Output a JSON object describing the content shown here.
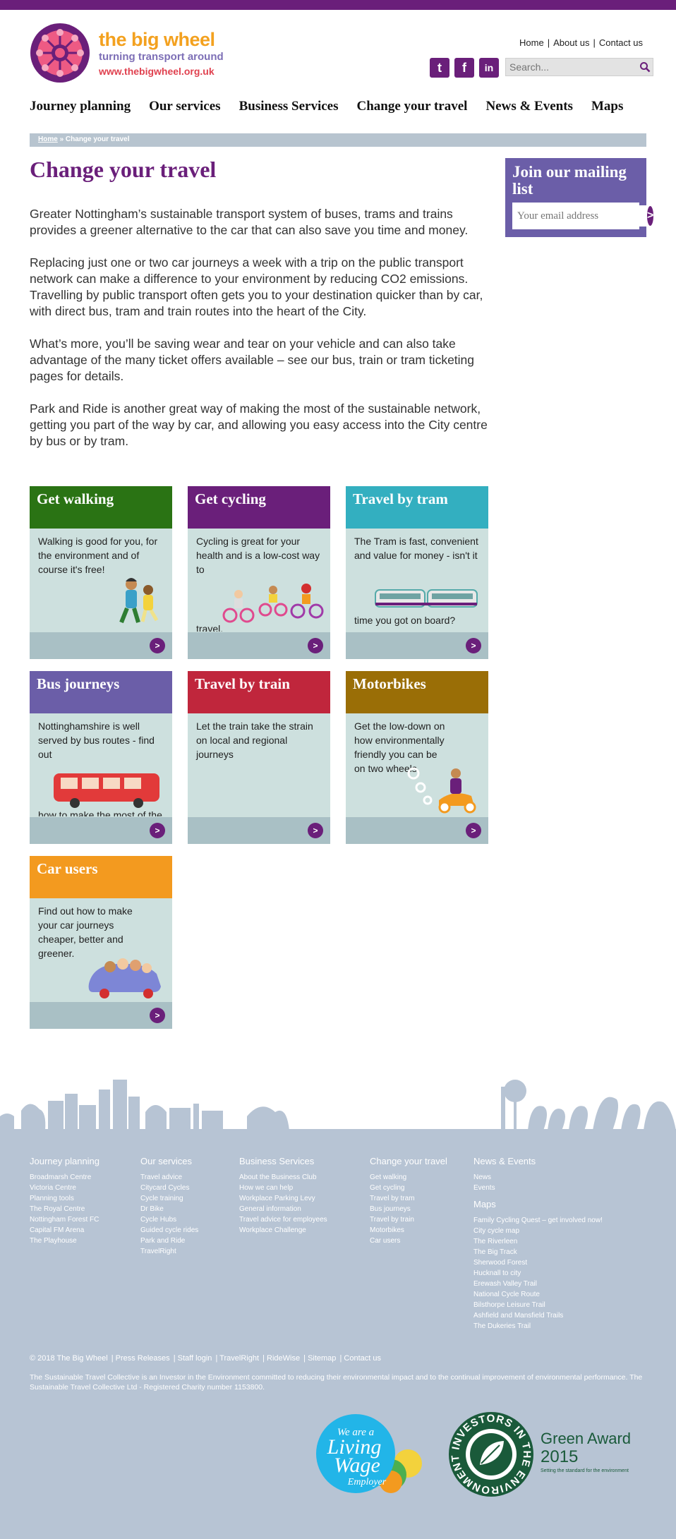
{
  "brand": {
    "name": "the big wheel",
    "tagline": "turning transport around",
    "url": "www.thebigwheel.org.uk"
  },
  "top_links": [
    "Home",
    "About us",
    "Contact us"
  ],
  "social": [
    {
      "icon": "twitter-icon",
      "glyph": "t"
    },
    {
      "icon": "facebook-icon",
      "glyph": "f"
    },
    {
      "icon": "linkedin-icon",
      "glyph": "in"
    }
  ],
  "search": {
    "placeholder": "Search..."
  },
  "nav": [
    "Journey planning",
    "Our services",
    "Business Services",
    "Change your travel",
    "News & Events",
    "Maps"
  ],
  "breadcrumb": {
    "home": "Home",
    "sep": "»",
    "current": "Change your travel"
  },
  "page_title": "Change your travel",
  "paragraphs": [
    "Greater Nottingham’s sustainable transport system of buses, trams and trains provides a greener alternative to the car that can also save you time and money.",
    "Replacing just one or two car journeys a week with a trip on the public transport network can make a difference to your environment by reducing CO2 emissions. Travelling by public transport often gets you to your destination quicker than by car, with direct bus, tram and train routes into the heart of the City.",
    "What’s more, you’ll be saving wear and tear on your vehicle and can also take advantage of the many ticket offers available – see our bus, train or tram ticketing pages for details.",
    "Park and Ride is another great way of making the most of the sustainable network, getting you part of the way by car, and allowing you easy access into the City centre by bus or by tram."
  ],
  "mailing": {
    "title": "Join our mailing list",
    "placeholder": "Your email address",
    "button": ">"
  },
  "cards": [
    {
      "title": "Get walking",
      "text": "Walking is good for you, for the environment and of course it's free!",
      "color": "#2a7314",
      "arrow": ">"
    },
    {
      "title": "Get cycling",
      "text": "Cycling is great for your health and is a low-cost way to",
      "text2": "travel.",
      "color": "#6a1f7a",
      "arrow": ">"
    },
    {
      "title": "Travel by tram",
      "text": "The Tram is fast, convenient and value for money - isn't it",
      "text2": "time you got on board?",
      "color": "#33afc0",
      "arrow": ">"
    },
    {
      "title": "Bus journeys",
      "text": "Nottinghamshire is well served by bus routes - find out",
      "text2": "how to make the most of the",
      "color": "#6b5ea8",
      "arrow": ">"
    },
    {
      "title": "Travel by train",
      "text": "Let the train take the strain on local and regional journeys",
      "color": "#c0263c",
      "arrow": ">"
    },
    {
      "title": "Motorbikes",
      "text": "Get the low-down on how environmentally friendly you can be on two wheels.",
      "color": "#9a6e06",
      "arrow": ">"
    },
    {
      "title": "Car users",
      "text": "Find out how to make your car journeys cheaper, better and greener.",
      "color": "#f39a1f",
      "arrow": ">"
    }
  ],
  "footer": {
    "columns": [
      {
        "title": "Journey planning",
        "links": [
          "Broadmarsh Centre",
          "Victoria Centre",
          "Planning tools",
          "The Royal Centre",
          "Nottingham Forest FC",
          "Capital FM Arena",
          "The Playhouse"
        ]
      },
      {
        "title": "Our services",
        "links": [
          "Travel advice",
          "Citycard Cycles",
          "Cycle training",
          "Dr Bike",
          "Cycle Hubs",
          "Guided cycle rides",
          "Park and Ride",
          "TravelRight"
        ]
      },
      {
        "title": "Business Services",
        "links": [
          "About the Business Club",
          "How we can help",
          "Workplace Parking Levy",
          "General information",
          "Travel advice for employees",
          "Workplace Challenge"
        ]
      },
      {
        "title": "Change your travel",
        "links": [
          "Get walking",
          "Get cycling",
          "Travel by tram",
          "Bus journeys",
          "Travel by train",
          "Motorbikes",
          "Car users"
        ]
      },
      {
        "title": "News & Events",
        "links": [
          "News",
          "Events"
        ],
        "title2": "Maps",
        "links2": [
          "Family Cycling Quest – get involved now!",
          "City cycle map",
          "The Riverleen",
          "The Big Track",
          "Sherwood Forest",
          "Hucknall to city",
          "Erewash Valley Trail",
          "National Cycle Route",
          "Bilsthorpe Leisure Trail",
          "Ashfield and Mansfield Trails",
          "The Dukeries Trail"
        ]
      }
    ],
    "bottom_links": [
      "© 2018  The Big Wheel",
      "Press Releases",
      "Staff login",
      "TravelRight",
      "RideWise",
      "Sitemap",
      "Contact us"
    ],
    "legal": "The Sustainable Travel Collective is an Investor in the Environment committed to reducing their environmental impact and to the continual improvement of environmental performance. The Sustainable Travel Collective Ltd - Registered Charity number 1153800.",
    "living_wage": {
      "l1": "We are a",
      "l2": "Living",
      "l3": "Wage",
      "l4": "Employer"
    },
    "iie": {
      "ring": "INVESTORS IN THE ENVIRONMENT",
      "award1": "Green Award",
      "award2": "2015",
      "award3": "Setting the standard for the environment"
    }
  },
  "colors": {
    "purple": "#6a1f7a",
    "footer": "#b7c4d4",
    "card_bg": "#cde0de"
  }
}
